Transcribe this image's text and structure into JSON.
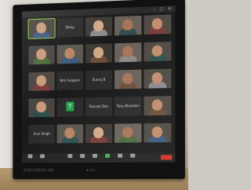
{
  "scene": {
    "description_tag": "photo-of-monitor",
    "monitor": {
      "bezel_brand": "acer",
      "bezel_model": "ACER V206HQL LED"
    },
    "meeting": {
      "participants": [
        {
          "name": "",
          "kind": "video",
          "active": true
        },
        {
          "name": "Dinky",
          "kind": "name-only"
        },
        {
          "name": "",
          "kind": "video"
        },
        {
          "name": "",
          "kind": "video"
        },
        {
          "name": "",
          "kind": "video"
        },
        {
          "name": "",
          "kind": "video"
        },
        {
          "name": "",
          "kind": "video"
        },
        {
          "name": "",
          "kind": "video"
        },
        {
          "name": "",
          "kind": "video"
        },
        {
          "name": "",
          "kind": "video"
        },
        {
          "name": "",
          "kind": "video"
        },
        {
          "name": "Nrla Sorgaon",
          "kind": "name-only"
        },
        {
          "name": "Sunny B",
          "kind": "name-only"
        },
        {
          "name": "",
          "kind": "video"
        },
        {
          "name": "",
          "kind": "video"
        },
        {
          "name": "",
          "kind": "video"
        },
        {
          "name": "T",
          "kind": "initial"
        },
        {
          "name": "Raunak Dan",
          "kind": "name-only"
        },
        {
          "name": "Tony Bhandari",
          "kind": "name-only"
        },
        {
          "name": "",
          "kind": "video"
        },
        {
          "name": "Arun Singh",
          "kind": "name-only"
        },
        {
          "name": "",
          "kind": "video"
        },
        {
          "name": "",
          "kind": "video"
        },
        {
          "name": "",
          "kind": "video"
        },
        {
          "name": "",
          "kind": "video"
        }
      ]
    }
  },
  "colors": {
    "screen_bg": "#1a1a1a",
    "tile_bg": "#2b2b2b",
    "active_outline": "#8cd14a",
    "end_button": "#d93025",
    "initial_tile": "#26a14d"
  }
}
